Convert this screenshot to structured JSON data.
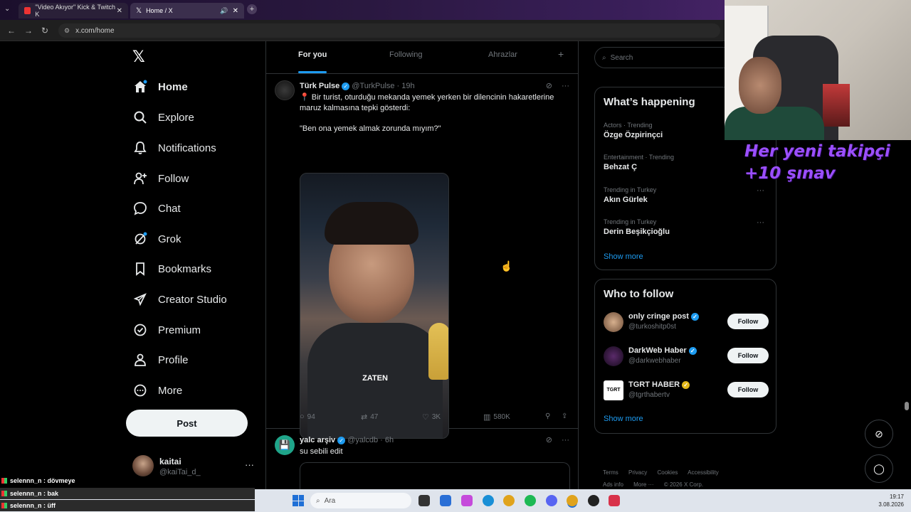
{
  "browser": {
    "tabs": [
      {
        "title": "\"Video Akıyor\" Kick & Twitch K"
      },
      {
        "title": "Home / X"
      }
    ],
    "url": "x.com/home"
  },
  "nav": {
    "items": [
      {
        "label": "Home",
        "icon": "home-icon"
      },
      {
        "label": "Explore",
        "icon": "search-icon"
      },
      {
        "label": "Notifications",
        "icon": "bell-icon"
      },
      {
        "label": "Follow",
        "icon": "person-plus-icon"
      },
      {
        "label": "Chat",
        "icon": "chat-icon"
      },
      {
        "label": "Grok",
        "icon": "grok-icon"
      },
      {
        "label": "Bookmarks",
        "icon": "bookmark-icon"
      },
      {
        "label": "Creator Studio",
        "icon": "rocket-icon"
      },
      {
        "label": "Premium",
        "icon": "premium-icon"
      },
      {
        "label": "Profile",
        "icon": "person-icon"
      },
      {
        "label": "More",
        "icon": "more-icon"
      }
    ],
    "post_label": "Post",
    "account": {
      "name": "kaitai",
      "handle": "@kaiTai_d_"
    }
  },
  "timeline": {
    "tabs": [
      "For you",
      "Following",
      "Ahrazlar"
    ],
    "tweets": [
      {
        "name": "Türk Pulse",
        "handle": "@TurkPulse",
        "time": "· 19h",
        "text1": "📍 Bir turist, oturduğu mekanda yemek yerken bir dilencinin hakaretlerine maruz kalmasına tepki gösterdi:",
        "text2": "\"Ben ona yemek almak zorunda mıyım?\"",
        "media_caption": "ZATEN",
        "replies": "94",
        "reposts": "47",
        "likes": "3K",
        "views": "580K"
      },
      {
        "name": "yalc arşiv",
        "handle": "@yalcdb",
        "time": "· 6h",
        "text1": "su sebili edit"
      }
    ]
  },
  "right": {
    "search_placeholder": "Search",
    "happening_title": "What’s happening",
    "trends": [
      {
        "meta": "Actors · Trending",
        "topic": "Özge Özpirinçci"
      },
      {
        "meta": "Entertainment · Trending",
        "topic": "Behzat Ç"
      },
      {
        "meta": "Trending in Turkey",
        "topic": "Akın Gürlek"
      },
      {
        "meta": "Trending in Turkey",
        "topic": "Derin Beşikçioğlu"
      }
    ],
    "show_more": "Show more",
    "who_to_follow_title": "Who to follow",
    "follow_suggestions": [
      {
        "name": "only cringe post",
        "handle": "@turkoshitp0st",
        "button": "Follow"
      },
      {
        "name": "DarkWeb Haber",
        "handle": "@darkwebhaber",
        "button": "Follow"
      },
      {
        "name": "TGRT HABER",
        "handle": "@tgrthabertv",
        "button": "Follow"
      }
    ],
    "footer": {
      "row1": [
        "Terms",
        "Privacy",
        "Cookies",
        "Accessibility"
      ],
      "row2": [
        "Ads info",
        "More ···",
        "© 2026 X Corp."
      ]
    }
  },
  "stream_overlay": {
    "text_line1": "Her yeni takipçi",
    "text_line2": "+10 şınav",
    "chat": [
      "selennn_n : dövmeye",
      "selennn_n : bak",
      "selennn_n : üff"
    ]
  },
  "taskbar": {
    "search_placeholder": "Ara",
    "time": "19:17",
    "date": "3.08.2026"
  },
  "colors": {
    "accent": "#1d9bf0",
    "background": "#000000",
    "overlay_text": "#9b4fff"
  }
}
